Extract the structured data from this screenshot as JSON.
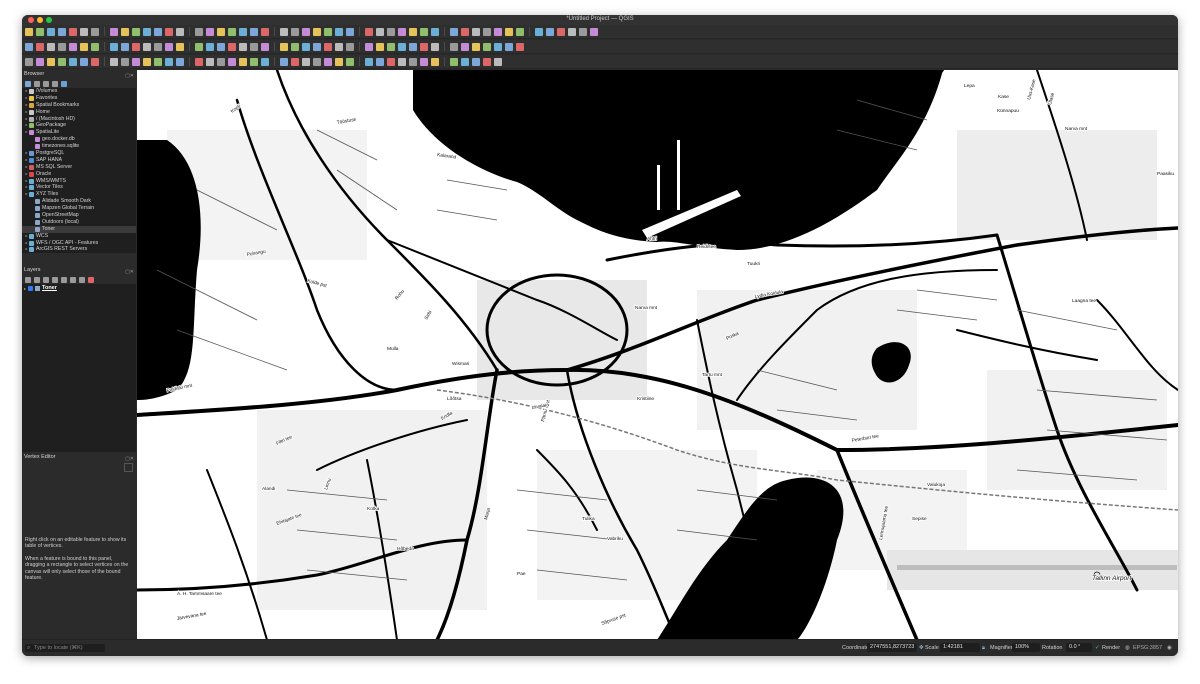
{
  "window": {
    "title": "*Untitled Project — QGIS"
  },
  "browser": {
    "title": "Browser",
    "items": [
      {
        "label": "/Volumes",
        "icon": "folder-icon",
        "color": "#c9c9c9"
      },
      {
        "label": "Favorites",
        "icon": "star-icon",
        "color": "#e8c547"
      },
      {
        "label": "Spatial Bookmarks",
        "icon": "bookmark-icon",
        "color": "#d9a441"
      },
      {
        "label": "Home",
        "icon": "folder-icon",
        "color": "#c9c9c9"
      },
      {
        "label": "/ (Macintosh HD)",
        "icon": "drive-icon",
        "color": "#b0b0b0"
      },
      {
        "label": "GeoPackage",
        "icon": "geopackage-icon",
        "color": "#8fbf6a"
      },
      {
        "label": "SpatiaLite",
        "icon": "spatialite-icon",
        "color": "#c58bd6"
      },
      {
        "label": "geo.docker.db",
        "icon": "database-icon",
        "color": "#c58bd6"
      },
      {
        "label": "timezones.sqlite",
        "icon": "database-icon",
        "color": "#c58bd6"
      },
      {
        "label": "PostgreSQL",
        "icon": "postgres-icon",
        "color": "#6a9ad6"
      },
      {
        "label": "SAP HANA",
        "icon": "hana-icon",
        "color": "#4c8fd6"
      },
      {
        "label": "MS SQL Server",
        "icon": "mssql-icon",
        "color": "#d65a5a"
      },
      {
        "label": "Oracle",
        "icon": "oracle-icon",
        "color": "#d64a4a"
      },
      {
        "label": "WMS/WMTS",
        "icon": "wms-icon",
        "color": "#6ab0d6"
      },
      {
        "label": "Vector Tiles",
        "icon": "vector-tiles-icon",
        "color": "#6ab0d6"
      },
      {
        "label": "XYZ Tiles",
        "icon": "xyz-tiles-icon",
        "color": "#6ab0d6"
      },
      {
        "label": "Alidade Smooth Dark",
        "icon": "tile-layer-icon",
        "color": "#8aa8c8"
      },
      {
        "label": "Mapzen Global Terrain",
        "icon": "tile-layer-icon",
        "color": "#8aa8c8"
      },
      {
        "label": "OpenStreetMap",
        "icon": "tile-layer-icon",
        "color": "#8aa8c8"
      },
      {
        "label": "Outdoors (local)",
        "icon": "tile-layer-icon",
        "color": "#8aa8c8"
      },
      {
        "label": "Toner",
        "icon": "tile-layer-icon",
        "color": "#8aa8c8"
      },
      {
        "label": "WCS",
        "icon": "wcs-icon",
        "color": "#6ab0d6"
      },
      {
        "label": "WFS / OGC API - Features",
        "icon": "wfs-icon",
        "color": "#6ab0d6"
      },
      {
        "label": "ArcGIS REST Servers",
        "icon": "arcgis-icon",
        "color": "#6ab0d6"
      }
    ]
  },
  "layers": {
    "title": "Layers",
    "items": [
      {
        "label": "Toner",
        "checked": true
      }
    ]
  },
  "vertex_editor": {
    "title": "Vertex Editor",
    "help_1": "Right click on an editable feature to show its table of vertices.",
    "help_2": "When a feature is bound to this panel, dragging a rectangle to select vertices on the canvas will only select those of the bound feature."
  },
  "status": {
    "locate_placeholder": "Type to locate (⌘K)",
    "coordinate_label": "Coordinate",
    "coordinate_value": "2747551,8273723",
    "scale_label": "Scale",
    "scale_value": "1:42181",
    "magnifier_label": "Magnifier",
    "magnifier_value": "100%",
    "rotation_label": "Rotation",
    "rotation_value": "0.0 °",
    "render_label": "Render",
    "crs_value": "EPSG:3857"
  },
  "map": {
    "labels": [
      "Lepa",
      "Kase",
      "Uus-Kase",
      "Künnapuu",
      "Ülase",
      "Narva mnt",
      "Paasiku",
      "Kalarand",
      "Tööstuse",
      "Kopli",
      "Puhangu",
      "Kolde pst",
      "Rohu",
      "Mulla",
      "Sirbi",
      "Narva mnt",
      "Reidi tee",
      "Tuukri",
      "Lydia Koidula",
      "Laagna tee",
      "Poska",
      "Tartu mnt",
      "Pärnu mnt",
      "Liivalaia",
      "Wismari",
      "Paldiski mnt",
      "Endla",
      "Filtri tee",
      "Peterburi tee",
      "Valukoja",
      "Sepise",
      "Tallinn Airport",
      "Tulika",
      "Vabriku",
      "Hõbeda",
      "Marja",
      "Sõpruse pst",
      "Järvevana tee",
      "A. H. Tammsaare tee",
      "Alandi",
      "Linnu",
      "Ehitajate tee",
      "Kotka",
      "Kristiine",
      "Lennujaama tee",
      "Lõõtsa",
      "Pae",
      "Ahtri"
    ]
  }
}
